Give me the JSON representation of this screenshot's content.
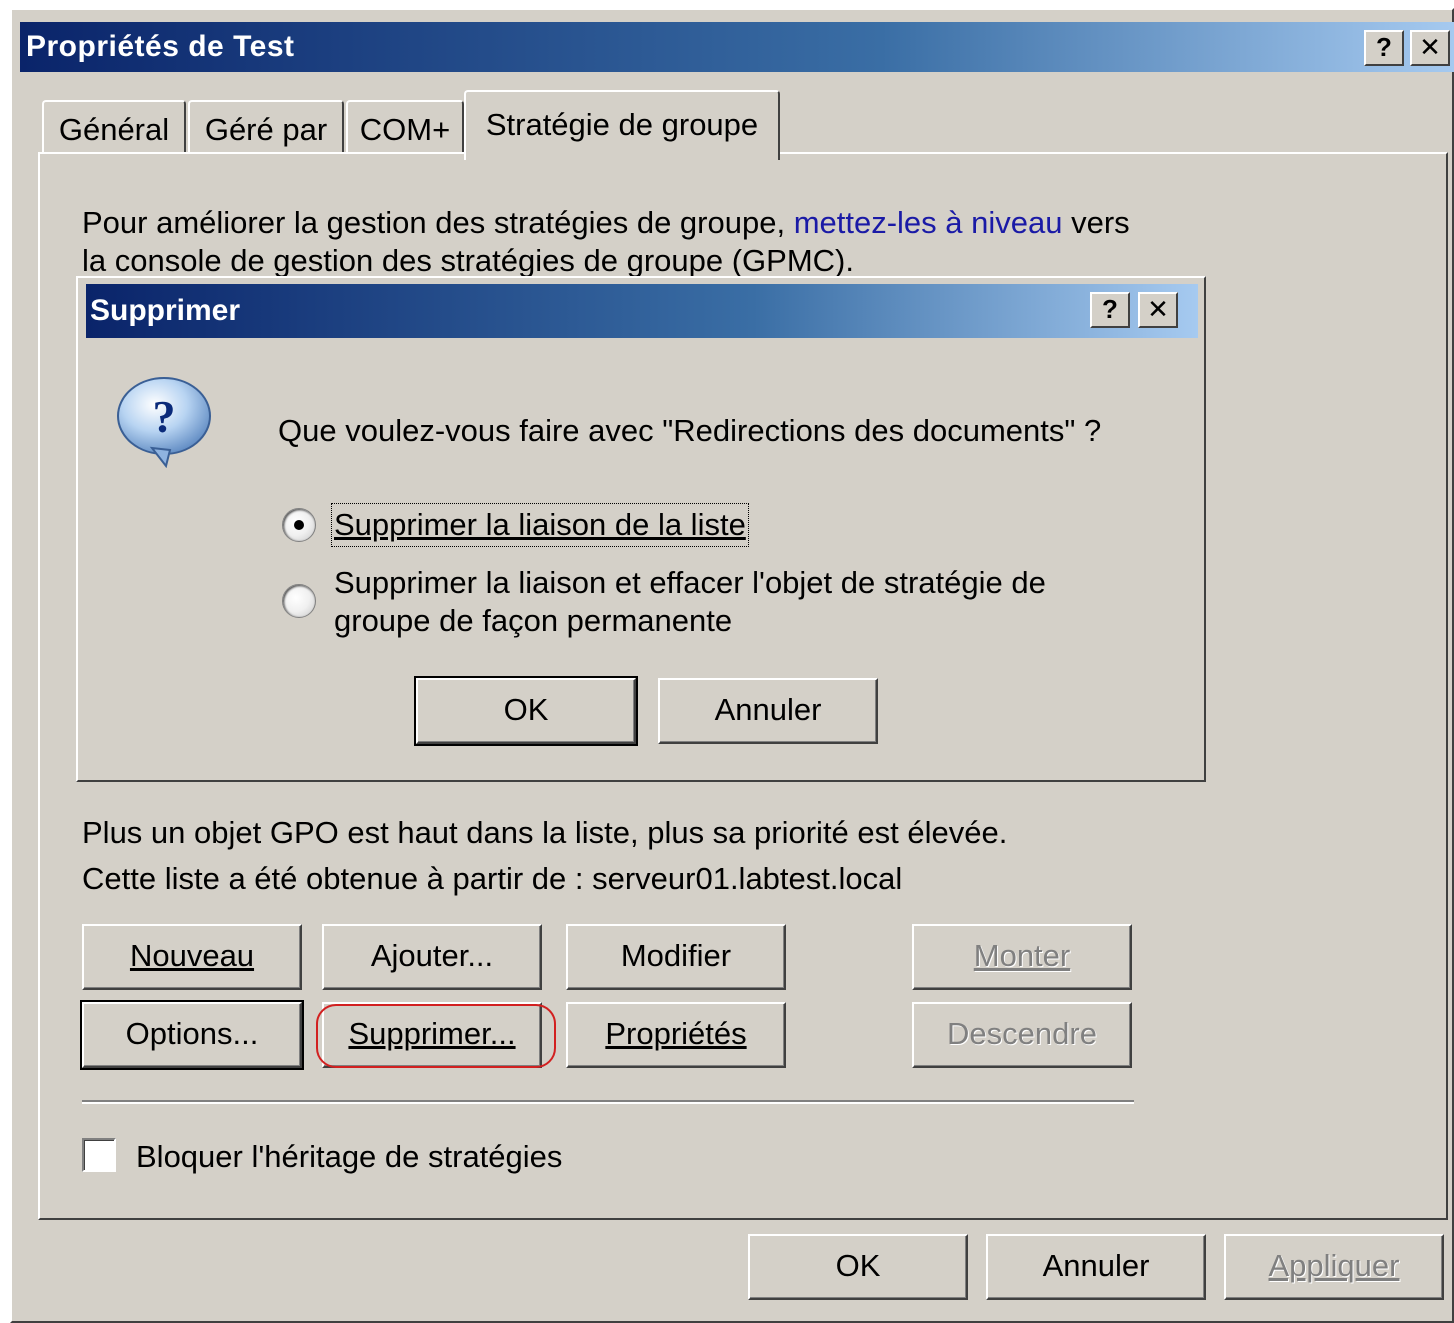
{
  "window": {
    "title": "Propriétés de Test",
    "help_label": "?",
    "close_label": "✕"
  },
  "tabs": [
    {
      "label": "Général"
    },
    {
      "label": "Géré par"
    },
    {
      "label": "COM+"
    },
    {
      "label": "Stratégie de groupe",
      "active": true
    }
  ],
  "panel": {
    "intro_part1": "Pour améliorer la gestion des stratégies de groupe, ",
    "intro_link": "mettez-les à niveau",
    "intro_part2": " vers",
    "intro_line2": "la console de gestion des stratégies de groupe (GPMC).",
    "priority_text": "Plus un objet GPO est haut dans la liste, plus sa priorité est élevée.",
    "source_text": "Cette liste a été obtenue à partir de : serveur01.labtest.local",
    "buttons": {
      "nouveau": "Nouveau",
      "ajouter": "Ajouter...",
      "modifier": "Modifier",
      "monter": "Monter",
      "options": "Options...",
      "supprimer": "Supprimer...",
      "proprietes": "Propriétés",
      "descendre": "Descendre"
    },
    "block_inheritance_label": "Bloquer l'héritage de stratégies",
    "block_inheritance_checked": false
  },
  "dialog": {
    "title": "Supprimer",
    "help_label": "?",
    "close_label": "✕",
    "question": "Que voulez-vous faire avec \"Redirections des documents\" ?",
    "question_icon": "question-icon",
    "options": [
      {
        "label": "Supprimer la liaison de la liste",
        "checked": true
      },
      {
        "label_line1": "Supprimer la liaison et effacer l'objet de stratégie de",
        "label_line2": "groupe de façon permanente",
        "checked": false
      }
    ],
    "ok_label": "OK",
    "cancel_label": "Annuler"
  },
  "footer": {
    "ok_label": "OK",
    "cancel_label": "Annuler",
    "apply_label": "Appliquer"
  },
  "colors": {
    "face": "#d4d0c8",
    "title_start": "#0a246a",
    "title_end": "#a6caf0",
    "link": "#1a1aa6",
    "highlight_ring": "#d22020"
  }
}
